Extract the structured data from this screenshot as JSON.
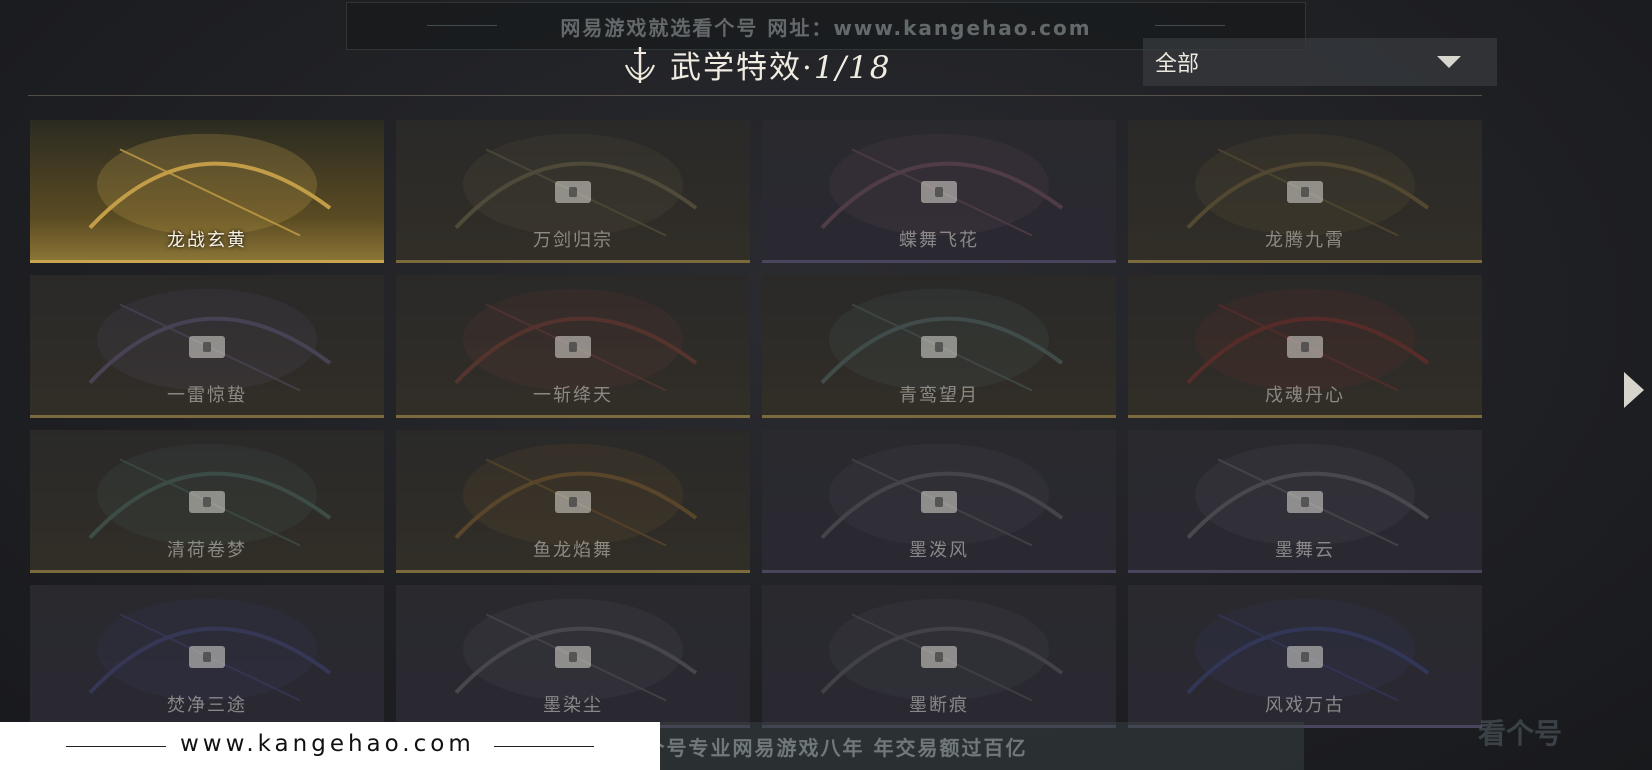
{
  "watermark": {
    "top_text": "网易游戏就选看个号  网址：www.kangehao.com",
    "bottom_url": "www.kangehao.com",
    "bottom_slogan": "看个号专业网易游戏八年  年交易额过百亿",
    "logo_text": "看个号"
  },
  "header": {
    "title": "武学特效·",
    "count": "1/18",
    "filter_value": "全部"
  },
  "cards": [
    {
      "label": "龙战玄黄",
      "locked": false,
      "tone": "active",
      "fx": "#c9a24a"
    },
    {
      "label": "万剑归宗",
      "locked": true,
      "tone": "gold",
      "fx": "#b9a86a"
    },
    {
      "label": "蝶舞飞花",
      "locked": true,
      "tone": "purple",
      "fx": "#c77a8e"
    },
    {
      "label": "龙腾九霄",
      "locked": true,
      "tone": "gold",
      "fx": "#c6a24c"
    },
    {
      "label": "一雷惊蛰",
      "locked": true,
      "tone": "gold",
      "fx": "#9f8ad6"
    },
    {
      "label": "一斩绛天",
      "locked": true,
      "tone": "gold",
      "fx": "#d0503f"
    },
    {
      "label": "青鸾望月",
      "locked": true,
      "tone": "gold",
      "fx": "#7fb2b0"
    },
    {
      "label": "戍魂丹心",
      "locked": true,
      "tone": "gold",
      "fx": "#d8322a"
    },
    {
      "label": "清荷卷梦",
      "locked": true,
      "tone": "gold",
      "fx": "#6fb0a0"
    },
    {
      "label": "鱼龙焰舞",
      "locked": true,
      "tone": "gold",
      "fx": "#e0962e"
    },
    {
      "label": "墨泼风",
      "locked": true,
      "tone": "purple",
      "fx": "#9a9aa0"
    },
    {
      "label": "墨舞云",
      "locked": true,
      "tone": "purple",
      "fx": "#a9a9ae"
    },
    {
      "label": "焚净三途",
      "locked": true,
      "tone": "purple",
      "fx": "#5b64c8"
    },
    {
      "label": "墨染尘",
      "locked": true,
      "tone": "purple",
      "fx": "#a0a0a4"
    },
    {
      "label": "墨断痕",
      "locked": true,
      "tone": "purple",
      "fx": "#8d8d92"
    },
    {
      "label": "风戏万古",
      "locked": true,
      "tone": "purple",
      "fx": "#4f5fd0"
    }
  ]
}
